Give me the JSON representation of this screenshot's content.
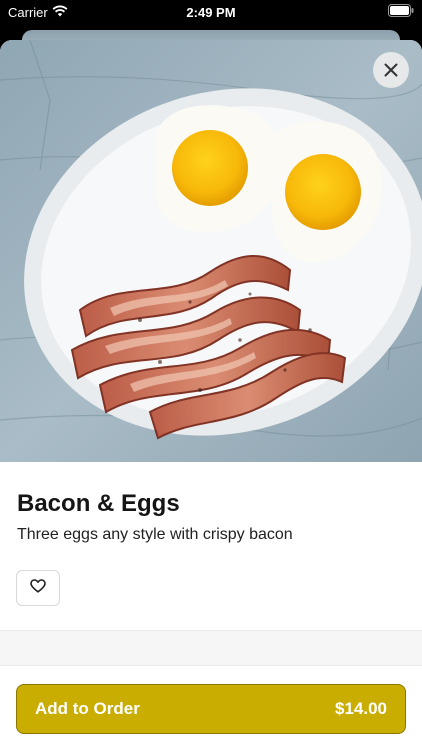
{
  "status_bar": {
    "carrier": "Carrier",
    "time": "2:49 PM"
  },
  "item": {
    "name": "Bacon & Eggs",
    "description": "Three eggs any style with crispy bacon"
  },
  "actions": {
    "add_label": "Add to Order",
    "price": "$14.00"
  },
  "colors": {
    "accent": "#c9ad00",
    "accent_border": "#8a7600"
  },
  "icons": {
    "close": "close-icon",
    "favorite": "heart-icon",
    "wifi": "wifi-icon",
    "battery": "battery-icon"
  }
}
